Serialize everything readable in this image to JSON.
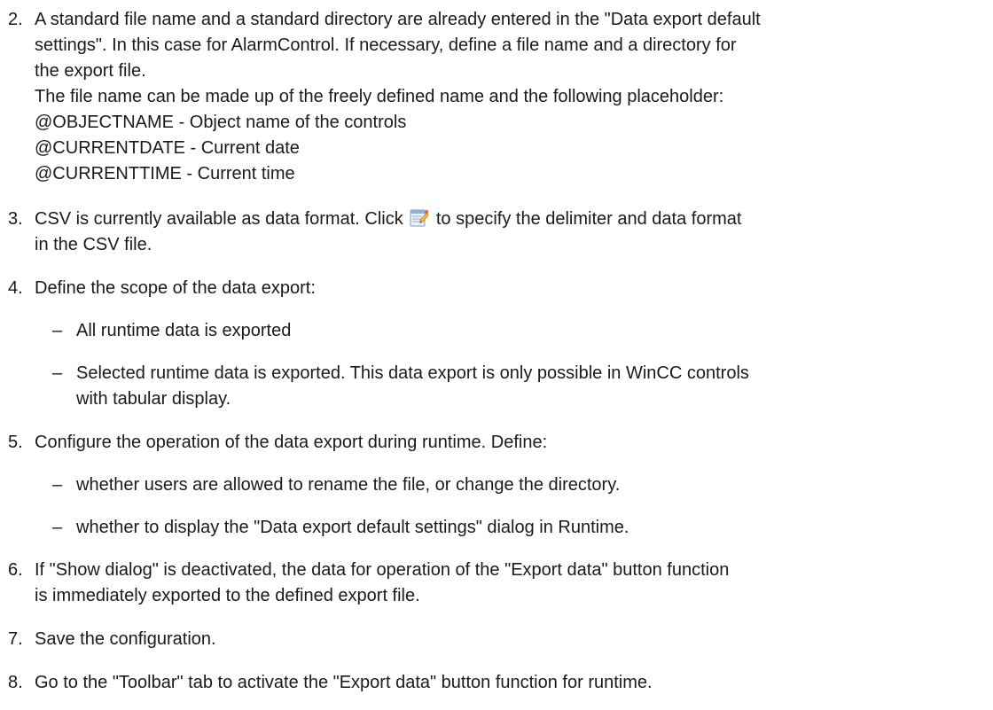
{
  "steps": [
    {
      "num": "2.",
      "lines": [
        "A standard file name and a standard directory are already entered in the \"Data export default",
        "settings\". In this case for AlarmControl. If necessary, define a file name and a directory for",
        "the export file.",
        "The file name can be made up of the freely defined name and the following placeholder:",
        "@OBJECTNAME - Object name of the controls",
        "@CURRENTDATE - Current date",
        "@CURRENTTIME - Current time"
      ]
    },
    {
      "num": "3.",
      "line1_before_icon": "CSV is currently available as data format. Click",
      "line1_after_icon": "to specify the delimiter and data format",
      "line2": "in the CSV file.",
      "icon": "csv-settings-icon"
    },
    {
      "num": "4.",
      "text": "Define the scope of the data export:",
      "subs": [
        {
          "dash": "–",
          "lines": [
            "All runtime data is exported"
          ]
        },
        {
          "dash": "–",
          "lines": [
            "Selected runtime data is exported. This data export is only possible in WinCC controls",
            "with tabular display."
          ]
        }
      ]
    },
    {
      "num": "5.",
      "text": "Configure the operation of the data export during runtime. Define:",
      "subs": [
        {
          "dash": "–",
          "lines": [
            "whether users are allowed to rename the file, or change the directory."
          ]
        },
        {
          "dash": "–",
          "lines": [
            "whether to display the \"Data export default settings\" dialog in Runtime."
          ]
        }
      ]
    },
    {
      "num": "6.",
      "lines": [
        "If \"Show dialog\" is deactivated, the data for operation of the \"Export data\" button function",
        "is immediately exported to the defined export file."
      ]
    },
    {
      "num": "7.",
      "text": "Save the configuration."
    },
    {
      "num": "8.",
      "text": "Go to the \"Toolbar\" tab to activate the \"Export data\" button function for runtime."
    }
  ]
}
